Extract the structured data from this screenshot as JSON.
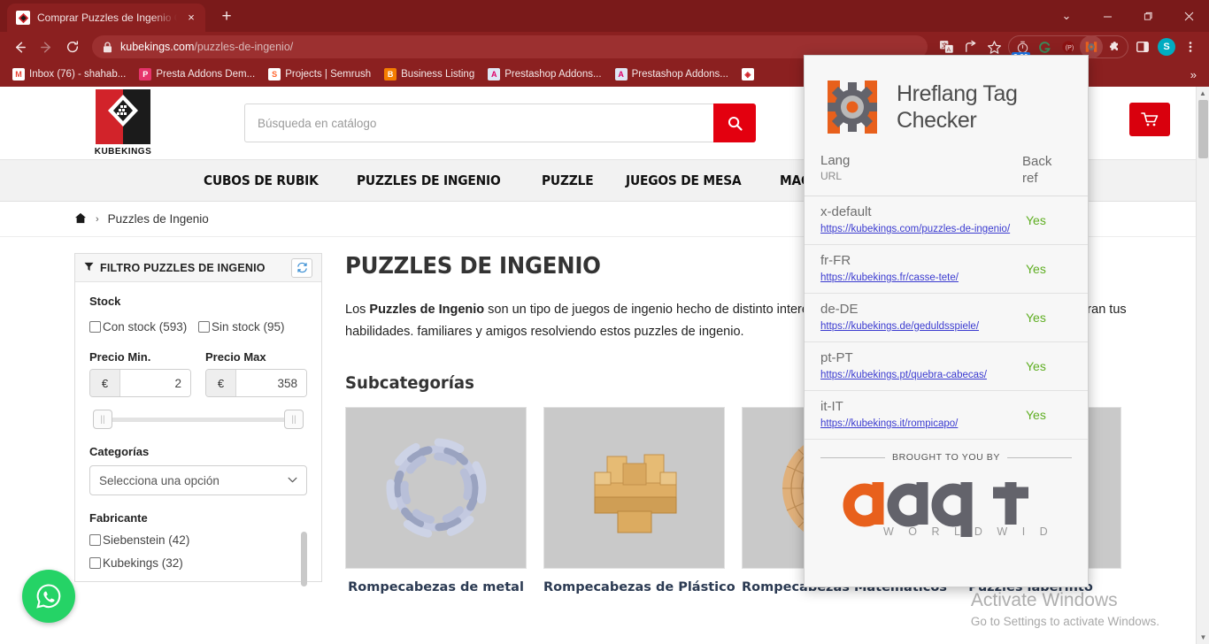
{
  "browser": {
    "tab": {
      "title": "Comprar Puzzles de Ingenio Onli",
      "close": "×",
      "favicon": "kubekings-favicon"
    },
    "newtab_label": "+",
    "window": {
      "minimize": "—",
      "maximize": "❐",
      "close": "✕",
      "chevron": "⌄"
    },
    "nav": {
      "back": "←",
      "forward": "→",
      "reload": "⟳"
    },
    "omnibox": {
      "lock": "🔒",
      "domain": "kubekings.com",
      "path": "/puzzles-de-ingenio/"
    },
    "timer_badge": "3.20",
    "avatar_initial": "S",
    "bookmarks": [
      {
        "label": "Inbox (76) - shahab...",
        "icon": "gmail-icon",
        "color": "#ea4335",
        "glyph": "M"
      },
      {
        "label": "Presta Addons Dem...",
        "icon": "presta-addons-icon",
        "color": "#df0067",
        "glyph": "P"
      },
      {
        "label": "Projects | Semrush",
        "icon": "semrush-icon",
        "color": "#ff642d",
        "glyph": "S"
      },
      {
        "label": "Business Listing",
        "icon": "blogger-icon",
        "color": "#f57d00",
        "glyph": "B"
      },
      {
        "label": "Prestashop Addons...",
        "icon": "prestashop-icon",
        "color": "#7986cb",
        "glyph": "A"
      },
      {
        "label": "Prestashop Addons...",
        "icon": "prestashop-icon",
        "color": "#7986cb",
        "glyph": "A"
      }
    ],
    "bookmarks_overflow": "»"
  },
  "site": {
    "logo_text": "KUBEKINGS",
    "search": {
      "placeholder": "Búsqueda en catálogo",
      "value": ""
    },
    "nav_items": [
      "CUBOS DE RUBIK",
      "PUZZLES DE INGENIO",
      "PUZZLE",
      "JUEGOS DE MESA",
      "MAQUETAS"
    ],
    "breadcrumb": {
      "home_icon": "home-icon",
      "separator": "›",
      "current": "Puzzles de Ingenio"
    }
  },
  "sidebar": {
    "filter_title": "FILTRO PUZZLES DE INGENIO",
    "filter_icon": "funnel-icon",
    "refresh_icon": "refresh-icon",
    "stock_label": "Stock",
    "stock_options": [
      {
        "label": "Con stock (593)",
        "checked": false
      },
      {
        "label": "Sin stock (95)",
        "checked": false
      }
    ],
    "price_min_label": "Precio Min.",
    "price_max_label": "Precio Max",
    "currency": "€",
    "price_min_value": "2",
    "price_max_value": "358",
    "categories_label": "Categorías",
    "categories_placeholder": "Selecciona una opción",
    "manufacturer_label": "Fabricante",
    "manufacturers": [
      {
        "label": "Siebenstein (42)",
        "checked": false
      },
      {
        "label": "Kubekings (32)",
        "checked": false
      }
    ]
  },
  "main": {
    "title": "PUZZLES DE INGENIO",
    "description_pre": "Los ",
    "description_bold": "Puzzles de Ingenio",
    "description_post": " son un tipo de juegos de ingenio hecho de distinto interesantes, estos puzzles de logica e ingenio desafiaran tus habilidades. familiares y amigos resolviendo estos puzzles de ingenio.",
    "subcat_title": "Subcategorías",
    "subcategories": [
      {
        "label": "Rompecabezas de metal",
        "image": "metal-ring-puzzle"
      },
      {
        "label": "Rompecabezas de Plástico",
        "image": "wooden-burr-puzzle"
      },
      {
        "label": "Rompecabezas Matemáticos",
        "image": "wooden-disc-puzzle"
      },
      {
        "label": "Puzzles laberinto",
        "image": "labyrinth-puzzle"
      }
    ]
  },
  "popup": {
    "title_line1": "Hreflang Tag",
    "title_line2": "Checker",
    "logo_icon": "hreflang-h-gear-logo",
    "header": {
      "lang": "Lang",
      "url": "URL",
      "backref_line1": "Back",
      "backref_line2": "ref"
    },
    "rows": [
      {
        "lang": "x-default",
        "url": "https://kubekings.com/puzzles-de-ingenio/",
        "backref": "Yes"
      },
      {
        "lang": "fr-FR",
        "url": "https://kubekings.fr/casse-tete/",
        "backref": "Yes"
      },
      {
        "lang": "de-DE",
        "url": "https://kubekings.de/geduldsspiele/",
        "backref": "Yes"
      },
      {
        "lang": "pt-PT",
        "url": "https://kubekings.pt/quebra-cabecas/",
        "backref": "Yes"
      },
      {
        "lang": "it-IT",
        "url": "https://kubekings.it/rompicapo/",
        "backref": "Yes"
      }
    ],
    "footer": {
      "brought": "BROUGHT  TO YOU BY",
      "brand": "adapt",
      "brand_sub": "W O R L D W I D E"
    }
  },
  "watermark": {
    "line1": "Activate Windows",
    "line2": "Go to Settings to activate Windows."
  },
  "colors": {
    "chrome": "#8b2020",
    "accent_red": "#e3000f",
    "link": "#3b3bd0",
    "yes_green": "#5fae22",
    "orange": "#e8601c"
  }
}
